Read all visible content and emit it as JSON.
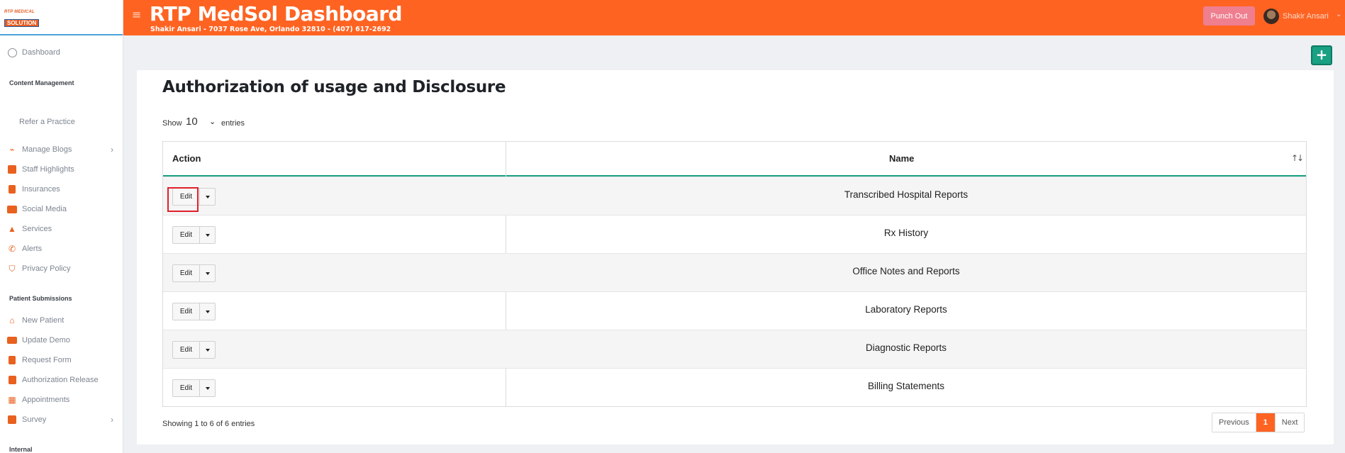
{
  "brand": {
    "logo_line1": "RTP MEDICAL",
    "logo_line2": "SOLUTION"
  },
  "header": {
    "title": "RTP MedSol Dashboard",
    "subtitle": "Shakir Ansari - 7037 Rose Ave, Orlando 32810 - (407) 617-2692",
    "punch_out": "Punch Out",
    "user_name": "Shakir Ansari"
  },
  "sidebar": {
    "dashboard": "Dashboard",
    "section_content": "Content Management",
    "refer": "Refer a Practice",
    "content_items": [
      {
        "label": "Manage Blogs",
        "icon": "blog-icon"
      },
      {
        "label": "Staff Highlights",
        "icon": "staff-icon"
      },
      {
        "label": "Insurances",
        "icon": "insurance-icon"
      },
      {
        "label": "Social Media",
        "icon": "social-media-icon"
      },
      {
        "label": "Services",
        "icon": "services-icon"
      },
      {
        "label": "Alerts",
        "icon": "phone-icon"
      },
      {
        "label": "Privacy Policy",
        "icon": "shield-icon"
      }
    ],
    "section_patient": "Patient Submissions",
    "patient_items": [
      {
        "label": "New Patient",
        "icon": "home-icon"
      },
      {
        "label": "Update Demo",
        "icon": "id-card-icon"
      },
      {
        "label": "Request Form",
        "icon": "file-icon"
      },
      {
        "label": "Authorization Release",
        "icon": "clipboard-check-icon"
      },
      {
        "label": "Appointments",
        "icon": "calendar-icon"
      },
      {
        "label": "Survey",
        "icon": "chart-icon"
      }
    ],
    "section_internal": "Internal"
  },
  "page": {
    "title": "Authorization of usage and Disclosure",
    "show_label": "Show",
    "entries_value": "10",
    "entries_label": "entries",
    "add_label": "+"
  },
  "table": {
    "headers": {
      "action": "Action",
      "name": "Name"
    },
    "edit_label": "Edit",
    "rows": [
      "Transcribed Hospital Reports",
      "Rx History",
      "Office Notes and Reports",
      "Laboratory Reports",
      "Diagnostic Reports",
      "Billing Statements"
    ]
  },
  "footer": {
    "info": "Showing 1 to 6 of 6 entries",
    "previous": "Previous",
    "page": "1",
    "next": "Next"
  },
  "colors": {
    "accent": "#fe6322",
    "green": "#1aa083",
    "punch": "#ef7e8f"
  }
}
